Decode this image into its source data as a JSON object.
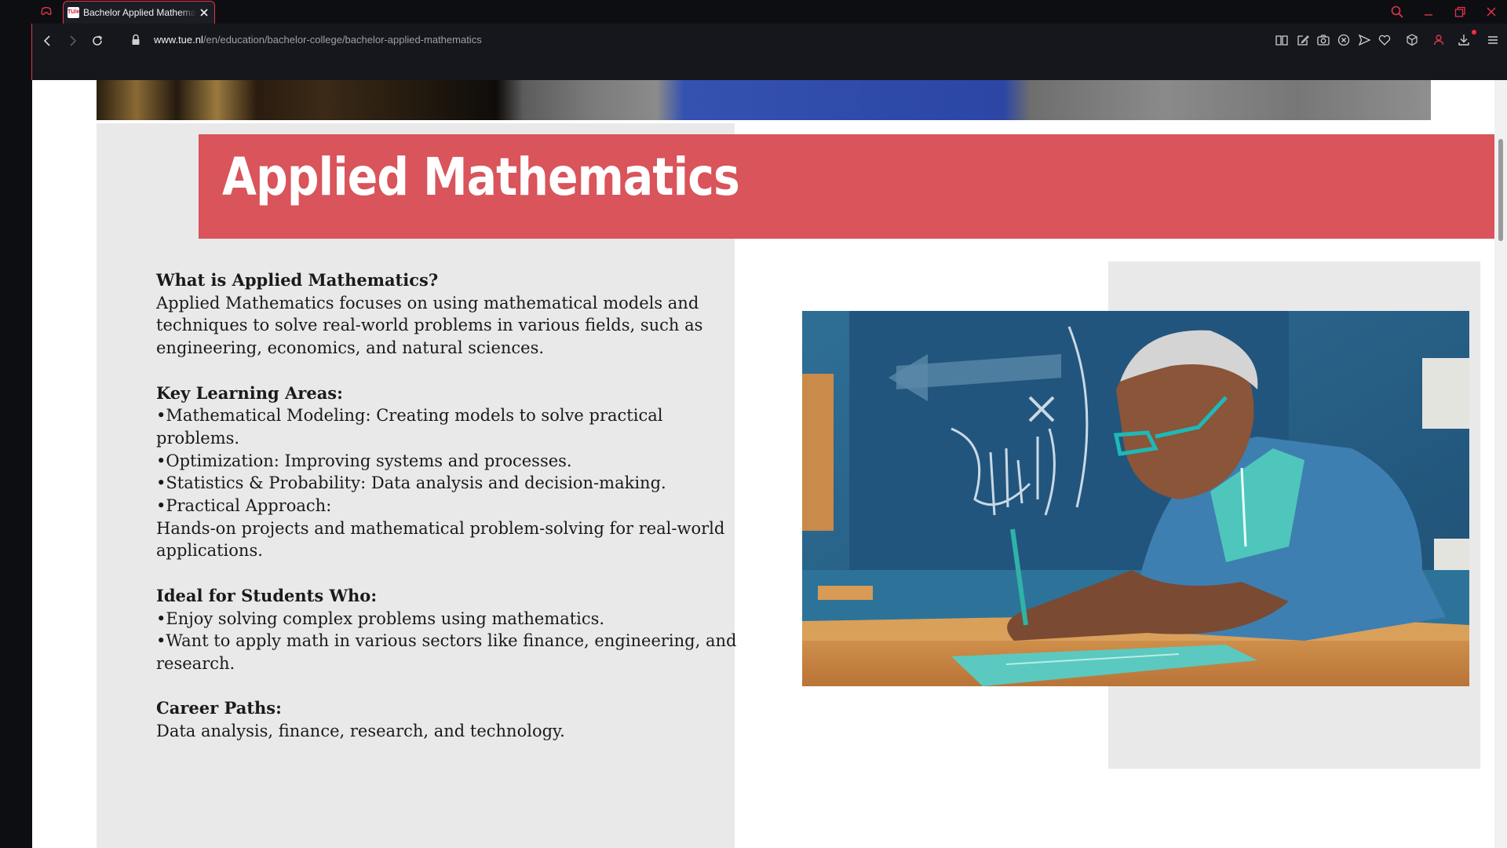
{
  "browser": {
    "tab": {
      "favicon_text": "TU/e",
      "title": "Bachelor Applied Mathematics"
    },
    "address": {
      "domain": "www.tue.nl",
      "path": "/en/education/bachelor-college/bachelor-applied-mathematics"
    },
    "accent_color": "#e0344a"
  },
  "page": {
    "title": "Applied Mathematics",
    "banner_color": "#d9545b",
    "sections": {
      "what": {
        "heading": "What is Applied Mathematics?",
        "lines": [
          "Applied Mathematics focuses on using mathematical models and",
          "techniques to solve real-world problems in various fields, such as",
          "engineering, economics, and natural sciences."
        ]
      },
      "learning": {
        "heading": "Key Learning Areas:",
        "lines": [
          "•Mathematical Modeling: Creating models to solve practical problems.",
          "•Optimization: Improving systems and processes.",
          "•Statistics & Probability: Data analysis and decision-making.",
          "•Practical Approach:",
          "Hands-on projects and mathematical problem-solving for real-world",
          "applications."
        ]
      },
      "ideal": {
        "heading": "Ideal for Students Who:",
        "lines": [
          "•Enjoy solving complex problems using mathematics.",
          "•Want to apply math in various sectors like finance, engineering, and",
          "research."
        ]
      },
      "career": {
        "heading": "Career Paths:",
        "lines": [
          "Data analysis, finance, research, and technology."
        ]
      }
    }
  }
}
